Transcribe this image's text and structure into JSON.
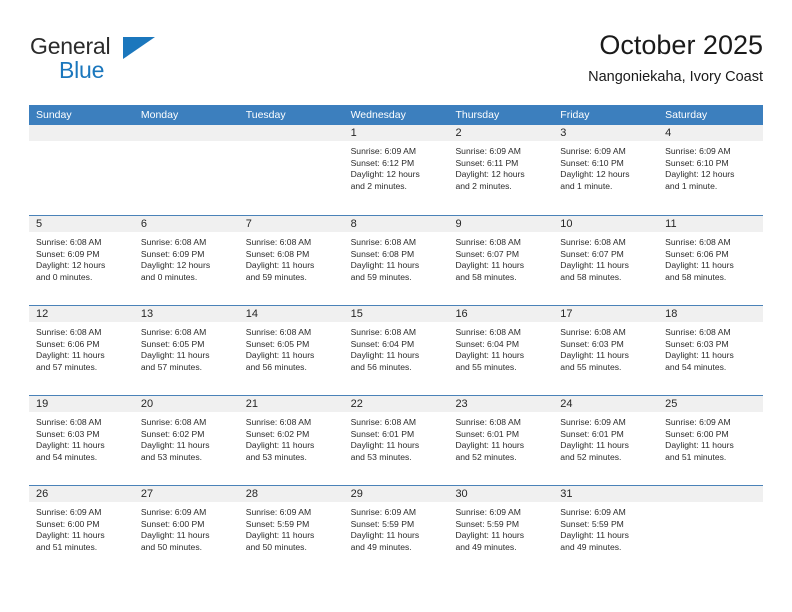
{
  "brand": {
    "name_top": "General",
    "name_bottom": "Blue",
    "accent_color": "#1b77bd",
    "triangle_icon": "triangle-icon"
  },
  "header": {
    "title": "October 2025",
    "subtitle": "Nangoniekaha, Ivory Coast"
  },
  "theme": {
    "header_row_bg": "#3c7fbe",
    "header_row_text": "#ffffff",
    "date_strip_bg": "#f0f0f0",
    "row_divider": "#4a82b8",
    "body_text": "#2b2b2b"
  },
  "calendar": {
    "weekday_headers": [
      "Sunday",
      "Monday",
      "Tuesday",
      "Wednesday",
      "Thursday",
      "Friday",
      "Saturday"
    ],
    "weeks": [
      [
        {
          "day": "",
          "lines": []
        },
        {
          "day": "",
          "lines": []
        },
        {
          "day": "",
          "lines": []
        },
        {
          "day": "1",
          "lines": [
            "Sunrise: 6:09 AM",
            "Sunset: 6:12 PM",
            "Daylight: 12 hours",
            "and 2 minutes."
          ]
        },
        {
          "day": "2",
          "lines": [
            "Sunrise: 6:09 AM",
            "Sunset: 6:11 PM",
            "Daylight: 12 hours",
            "and 2 minutes."
          ]
        },
        {
          "day": "3",
          "lines": [
            "Sunrise: 6:09 AM",
            "Sunset: 6:10 PM",
            "Daylight: 12 hours",
            "and 1 minute."
          ]
        },
        {
          "day": "4",
          "lines": [
            "Sunrise: 6:09 AM",
            "Sunset: 6:10 PM",
            "Daylight: 12 hours",
            "and 1 minute."
          ]
        }
      ],
      [
        {
          "day": "5",
          "lines": [
            "Sunrise: 6:08 AM",
            "Sunset: 6:09 PM",
            "Daylight: 12 hours",
            "and 0 minutes."
          ]
        },
        {
          "day": "6",
          "lines": [
            "Sunrise: 6:08 AM",
            "Sunset: 6:09 PM",
            "Daylight: 12 hours",
            "and 0 minutes."
          ]
        },
        {
          "day": "7",
          "lines": [
            "Sunrise: 6:08 AM",
            "Sunset: 6:08 PM",
            "Daylight: 11 hours",
            "and 59 minutes."
          ]
        },
        {
          "day": "8",
          "lines": [
            "Sunrise: 6:08 AM",
            "Sunset: 6:08 PM",
            "Daylight: 11 hours",
            "and 59 minutes."
          ]
        },
        {
          "day": "9",
          "lines": [
            "Sunrise: 6:08 AM",
            "Sunset: 6:07 PM",
            "Daylight: 11 hours",
            "and 58 minutes."
          ]
        },
        {
          "day": "10",
          "lines": [
            "Sunrise: 6:08 AM",
            "Sunset: 6:07 PM",
            "Daylight: 11 hours",
            "and 58 minutes."
          ]
        },
        {
          "day": "11",
          "lines": [
            "Sunrise: 6:08 AM",
            "Sunset: 6:06 PM",
            "Daylight: 11 hours",
            "and 58 minutes."
          ]
        }
      ],
      [
        {
          "day": "12",
          "lines": [
            "Sunrise: 6:08 AM",
            "Sunset: 6:06 PM",
            "Daylight: 11 hours",
            "and 57 minutes."
          ]
        },
        {
          "day": "13",
          "lines": [
            "Sunrise: 6:08 AM",
            "Sunset: 6:05 PM",
            "Daylight: 11 hours",
            "and 57 minutes."
          ]
        },
        {
          "day": "14",
          "lines": [
            "Sunrise: 6:08 AM",
            "Sunset: 6:05 PM",
            "Daylight: 11 hours",
            "and 56 minutes."
          ]
        },
        {
          "day": "15",
          "lines": [
            "Sunrise: 6:08 AM",
            "Sunset: 6:04 PM",
            "Daylight: 11 hours",
            "and 56 minutes."
          ]
        },
        {
          "day": "16",
          "lines": [
            "Sunrise: 6:08 AM",
            "Sunset: 6:04 PM",
            "Daylight: 11 hours",
            "and 55 minutes."
          ]
        },
        {
          "day": "17",
          "lines": [
            "Sunrise: 6:08 AM",
            "Sunset: 6:03 PM",
            "Daylight: 11 hours",
            "and 55 minutes."
          ]
        },
        {
          "day": "18",
          "lines": [
            "Sunrise: 6:08 AM",
            "Sunset: 6:03 PM",
            "Daylight: 11 hours",
            "and 54 minutes."
          ]
        }
      ],
      [
        {
          "day": "19",
          "lines": [
            "Sunrise: 6:08 AM",
            "Sunset: 6:03 PM",
            "Daylight: 11 hours",
            "and 54 minutes."
          ]
        },
        {
          "day": "20",
          "lines": [
            "Sunrise: 6:08 AM",
            "Sunset: 6:02 PM",
            "Daylight: 11 hours",
            "and 53 minutes."
          ]
        },
        {
          "day": "21",
          "lines": [
            "Sunrise: 6:08 AM",
            "Sunset: 6:02 PM",
            "Daylight: 11 hours",
            "and 53 minutes."
          ]
        },
        {
          "day": "22",
          "lines": [
            "Sunrise: 6:08 AM",
            "Sunset: 6:01 PM",
            "Daylight: 11 hours",
            "and 53 minutes."
          ]
        },
        {
          "day": "23",
          "lines": [
            "Sunrise: 6:08 AM",
            "Sunset: 6:01 PM",
            "Daylight: 11 hours",
            "and 52 minutes."
          ]
        },
        {
          "day": "24",
          "lines": [
            "Sunrise: 6:09 AM",
            "Sunset: 6:01 PM",
            "Daylight: 11 hours",
            "and 52 minutes."
          ]
        },
        {
          "day": "25",
          "lines": [
            "Sunrise: 6:09 AM",
            "Sunset: 6:00 PM",
            "Daylight: 11 hours",
            "and 51 minutes."
          ]
        }
      ],
      [
        {
          "day": "26",
          "lines": [
            "Sunrise: 6:09 AM",
            "Sunset: 6:00 PM",
            "Daylight: 11 hours",
            "and 51 minutes."
          ]
        },
        {
          "day": "27",
          "lines": [
            "Sunrise: 6:09 AM",
            "Sunset: 6:00 PM",
            "Daylight: 11 hours",
            "and 50 minutes."
          ]
        },
        {
          "day": "28",
          "lines": [
            "Sunrise: 6:09 AM",
            "Sunset: 5:59 PM",
            "Daylight: 11 hours",
            "and 50 minutes."
          ]
        },
        {
          "day": "29",
          "lines": [
            "Sunrise: 6:09 AM",
            "Sunset: 5:59 PM",
            "Daylight: 11 hours",
            "and 49 minutes."
          ]
        },
        {
          "day": "30",
          "lines": [
            "Sunrise: 6:09 AM",
            "Sunset: 5:59 PM",
            "Daylight: 11 hours",
            "and 49 minutes."
          ]
        },
        {
          "day": "31",
          "lines": [
            "Sunrise: 6:09 AM",
            "Sunset: 5:59 PM",
            "Daylight: 11 hours",
            "and 49 minutes."
          ]
        },
        {
          "day": "",
          "lines": []
        }
      ]
    ]
  }
}
